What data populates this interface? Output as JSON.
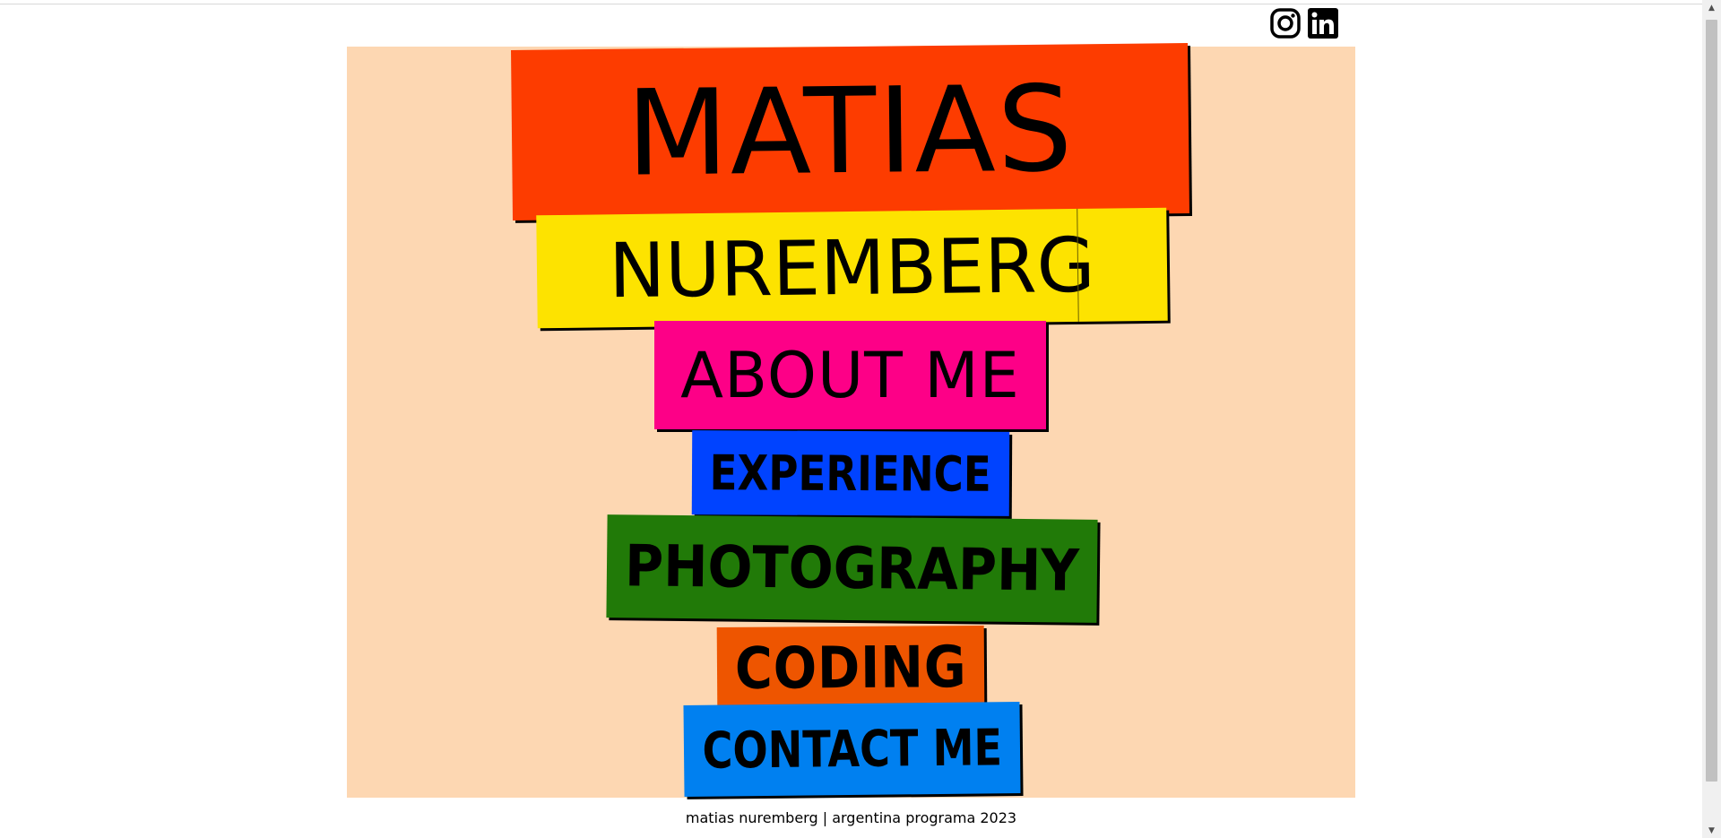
{
  "social": {
    "instagram_label": "Instagram",
    "linkedin_label": "LinkedIn"
  },
  "title": {
    "first_name": "MATIAS",
    "last_name": "NUREMBERG"
  },
  "menu": {
    "items": [
      {
        "label": "ABOUT ME",
        "color": "#fd0087"
      },
      {
        "label": "EXPERIENCE",
        "color": "#0043ff"
      },
      {
        "label": "PHOTOGRAPHY",
        "color": "#217a08"
      },
      {
        "label": "CODING",
        "color": "#ee5500"
      },
      {
        "label": "CONTACT ME",
        "color": "#0080f0"
      }
    ]
  },
  "colors": {
    "background": "#fdd7b2",
    "matias": "#fd3c00",
    "nuremberg": "#fde300"
  },
  "footer": {
    "text": "matias nuremberg | argentina programa 2023"
  }
}
